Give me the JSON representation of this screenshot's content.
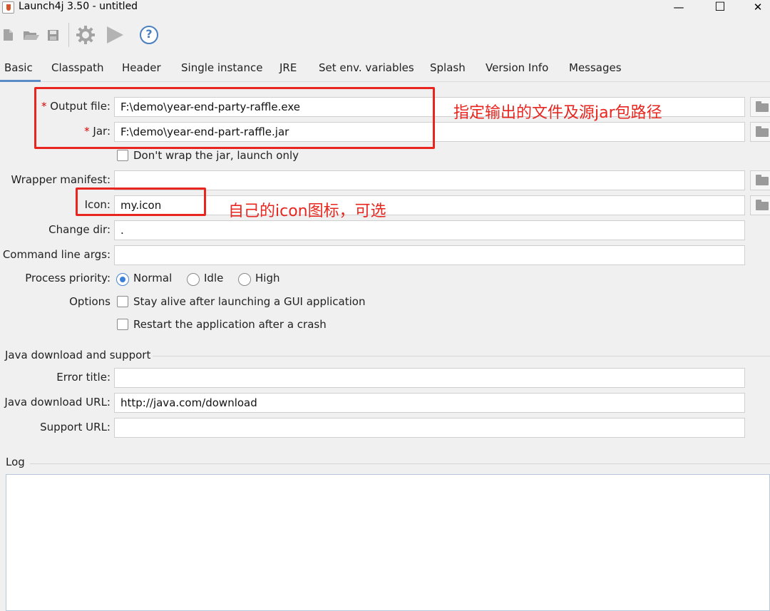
{
  "window": {
    "title": "Launch4j 3.50 - untitled",
    "controls": {
      "minimize": "—",
      "maximize": "☐",
      "close": "✕"
    }
  },
  "toolbar": {
    "icons": [
      "new-file-icon",
      "open-folder-icon",
      "save-icon",
      "settings-gear-icon",
      "run-play-icon",
      "help-icon"
    ],
    "help_glyph": "?"
  },
  "tabs": [
    {
      "label": "Basic",
      "active": true
    },
    {
      "label": "Classpath"
    },
    {
      "label": "Header"
    },
    {
      "label": "Single instance"
    },
    {
      "label": "JRE"
    },
    {
      "label": "Set env. variables"
    },
    {
      "label": "Splash"
    },
    {
      "label": "Version Info"
    },
    {
      "label": "Messages"
    }
  ],
  "basic": {
    "output_file": {
      "required_mark": "*",
      "label": "Output file:",
      "value": "F:\\demo\\year-end-party-raffle.exe"
    },
    "jar": {
      "required_mark": "*",
      "label": "Jar:",
      "value": "F:\\demo\\year-end-part-raffle.jar"
    },
    "dont_wrap": {
      "label": "Don't wrap the jar, launch only",
      "checked": false
    },
    "wrapper_manifest": {
      "label": "Wrapper manifest:",
      "value": ""
    },
    "icon": {
      "label": "Icon:",
      "value": "my.icon"
    },
    "change_dir": {
      "label": "Change dir:",
      "value": "."
    },
    "cmd_args": {
      "label": "Command line args:",
      "value": ""
    },
    "priority": {
      "label": "Process priority:",
      "options": [
        "Normal",
        "Idle",
        "High"
      ],
      "selected": "Normal"
    },
    "options": {
      "label": "Options",
      "stay_alive": "Stay alive after launching a GUI application",
      "restart": "Restart the application after a crash"
    }
  },
  "java_download": {
    "section_title": "Java download and support",
    "error_title": {
      "label": "Error title:",
      "value": ""
    },
    "download_url": {
      "label": "Java download URL:",
      "value": "http://java.com/download"
    },
    "support_url": {
      "label": "Support URL:",
      "value": ""
    }
  },
  "log": {
    "title": "Log"
  },
  "annotations": {
    "output_jar_note": "指定输出的文件及源jar包路径",
    "icon_note": "自己的icon图标，可选",
    "color": "#e8261f"
  }
}
